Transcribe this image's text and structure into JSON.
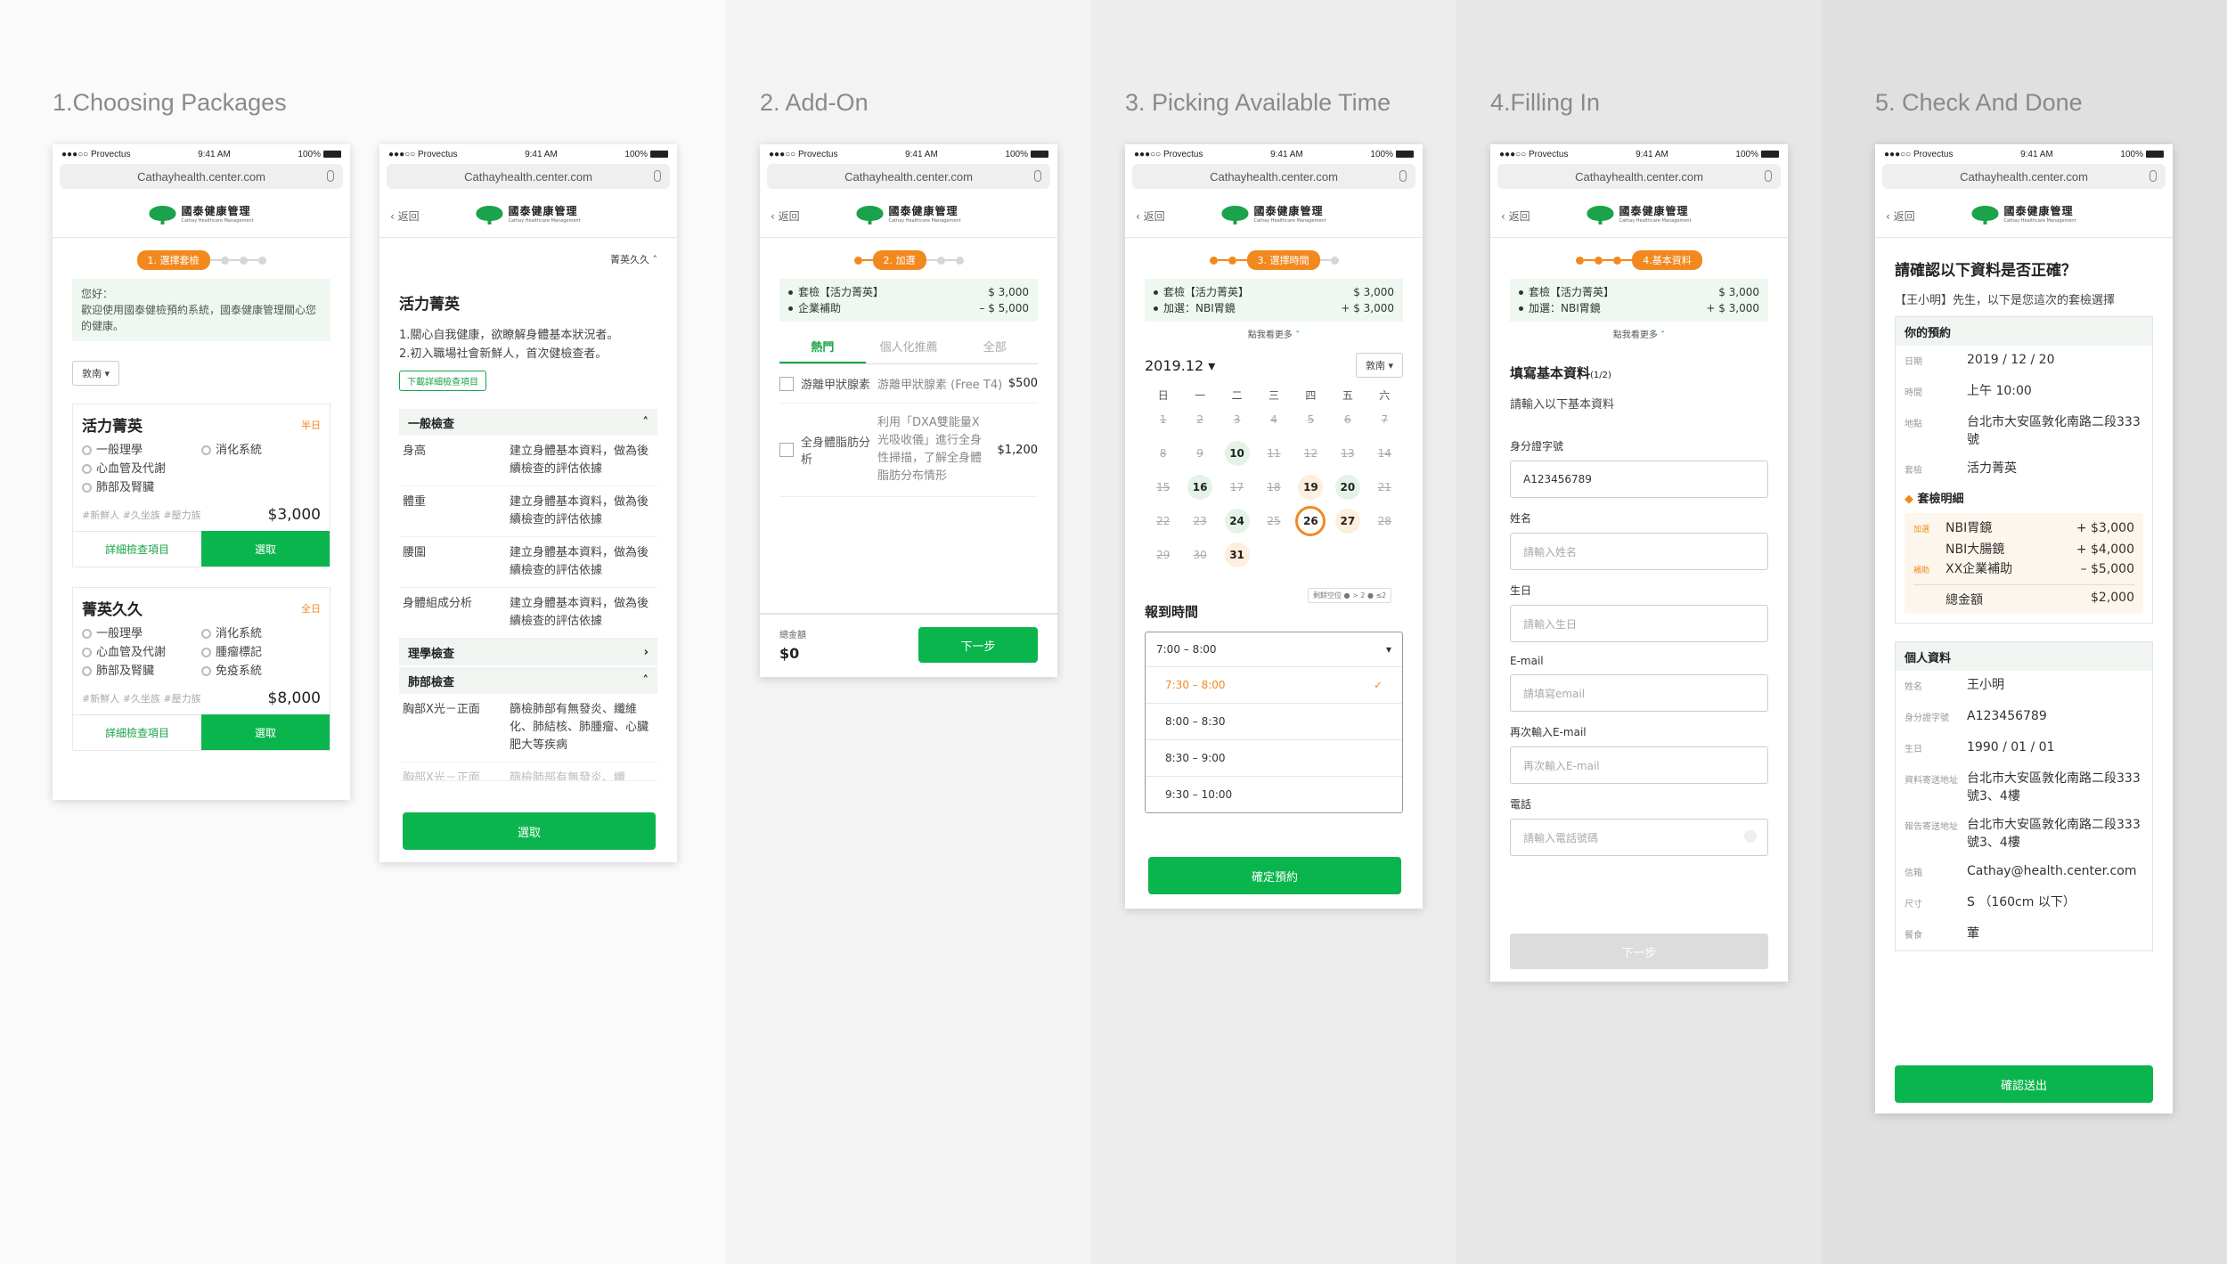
{
  "stages": [
    {
      "title": "1.Choosing Packages"
    },
    {
      "title": "2. Add-On"
    },
    {
      "title": "3. Picking Available Time"
    },
    {
      "title": "4.Filling In"
    },
    {
      "title": "5. Check And Done"
    }
  ],
  "common": {
    "carrier": "●●●○○ Provectus",
    "time": "9:41 AM",
    "battery": "100%",
    "url": "Cathayhealth.center.com",
    "back": "返回",
    "logo_zh": "國泰健康管理",
    "logo_en": "Cathay Healthcare Management"
  },
  "p1": {
    "step": "1. 選擇套檢",
    "greet_title": "您好：",
    "greet_body": "歡迎使用國泰健檢預約系統，國泰健康管理關心您的健康。",
    "filter": "敦南",
    "pkg1": {
      "name": "活力菁英",
      "tag": "半日",
      "f1": "一般理學",
      "f2": "消化系統",
      "f3": "心血管及代謝",
      "f4": "肺部及腎臟",
      "hash": "#新鮮人 #久坐族 #壓力族",
      "price": "$3,000",
      "detail": "詳細檢查項目",
      "choose": "選取"
    },
    "pkg2": {
      "name": "菁英久久",
      "tag": "全日",
      "f1": "一般理學",
      "f2": "消化系統",
      "f3": "心血管及代謝",
      "f4": "腫瘤標記",
      "f5": "肺部及腎臟",
      "f6": "免疫系統",
      "hash": "#新鮮人 #久坐族 #壓力族",
      "price": "$8,000",
      "detail": "詳細檢查項目",
      "choose": "選取"
    }
  },
  "p1b": {
    "collapse": "菁英久久",
    "title": "活力菁英",
    "desc1": "1.關心自我健康，欲瞭解身體基本狀況者。",
    "desc2": "2.初入職場社會新鮮人，首次健檢查者。",
    "download": "下載詳細檢查項目",
    "sec1": "一般檢查",
    "rows": [
      {
        "k": "身高",
        "v": "建立身體基本資料，做為後續檢查的評估依據"
      },
      {
        "k": "體重",
        "v": "建立身體基本資料，做為後續檢查的評估依據"
      },
      {
        "k": "腰圍",
        "v": "建立身體基本資料，做為後續檢查的評估依據"
      },
      {
        "k": "身體組成分析",
        "v": "建立身體基本資料，做為後續檢查的評估依據"
      }
    ],
    "sec2": "理學檢查",
    "sec3": "肺部檢查",
    "lung_k": "胸部X光－正面",
    "lung_v": "篩檢肺部有無發炎、纖維化、肺結核、肺腫瘤、心臟肥大等疾病",
    "lung_k2": "胸部X光－正面",
    "lung_v2": "篩檢肺部有無發炎、纖",
    "choose": "選取"
  },
  "p2": {
    "step": "2. 加選",
    "sum": [
      {
        "k": "套檢【活力菁英】",
        "v": "$ 3,000"
      },
      {
        "k": "企業補助",
        "v": "– $ 5,000"
      }
    ],
    "tabs": [
      "熱門",
      "個人化推薦",
      "全部"
    ],
    "a1": {
      "name": "游離甲狀腺素",
      "desc": "游離甲狀腺素 (Free T4)",
      "price": "$500"
    },
    "a2": {
      "name": "全身體脂肪分析",
      "desc": "利用「DXA雙能量X光吸收儀」進行全身性掃描，了解全身體脂肪分布情形",
      "price": "$1,200"
    },
    "total_label": "總金額",
    "total": "$0",
    "next": "下一步"
  },
  "p3": {
    "step": "3. 選擇時間",
    "sum": [
      {
        "k": "套檢【活力菁英】",
        "v": "$ 3,000"
      },
      {
        "k": "加選：NBI胃鏡",
        "v": "+ $ 3,000"
      }
    ],
    "more": "點我看更多",
    "month": "2019.12",
    "loc": "敦南",
    "weekdays": [
      "日",
      "一",
      "二",
      "三",
      "四",
      "五",
      "六"
    ],
    "days": [
      {
        "d": "1",
        "s": "past"
      },
      {
        "d": "2",
        "s": "past"
      },
      {
        "d": "3",
        "s": "past"
      },
      {
        "d": "4",
        "s": "past"
      },
      {
        "d": "5",
        "s": "past"
      },
      {
        "d": "6",
        "s": "past"
      },
      {
        "d": "7",
        "s": "past"
      },
      {
        "d": "8",
        "s": "past"
      },
      {
        "d": "9",
        "s": "past"
      },
      {
        "d": "10",
        "s": "avail"
      },
      {
        "d": "11",
        "s": "past"
      },
      {
        "d": "12",
        "s": "past"
      },
      {
        "d": "13",
        "s": "past"
      },
      {
        "d": "14",
        "s": "past"
      },
      {
        "d": "15",
        "s": "past"
      },
      {
        "d": "16",
        "s": "avail"
      },
      {
        "d": "17",
        "s": "past"
      },
      {
        "d": "18",
        "s": "past"
      },
      {
        "d": "19",
        "s": "few"
      },
      {
        "d": "20",
        "s": "avail"
      },
      {
        "d": "21",
        "s": "past"
      },
      {
        "d": "22",
        "s": "past"
      },
      {
        "d": "23",
        "s": "past"
      },
      {
        "d": "24",
        "s": "avail"
      },
      {
        "d": "25",
        "s": "past"
      },
      {
        "d": "26",
        "s": "sel"
      },
      {
        "d": "27",
        "s": "few"
      },
      {
        "d": "28",
        "s": "past"
      },
      {
        "d": "29",
        "s": "past"
      },
      {
        "d": "30",
        "s": "past"
      },
      {
        "d": "31",
        "s": "few"
      }
    ],
    "legend": "剩餘空位 ● > 2 ● ≤2",
    "time_title": "報到時間",
    "time_value": "7:00 – 8:00",
    "options": [
      "7:30 – 8:00",
      "8:00 – 8:30",
      "8:30 – 9:00",
      "9:30 – 10:00"
    ],
    "confirm": "確定預約"
  },
  "p4": {
    "step": "4.基本資料",
    "sum": [
      {
        "k": "套檢【活力菁英】",
        "v": "$ 3,000"
      },
      {
        "k": "加選：NBI胃鏡",
        "v": "+ $ 3,000"
      }
    ],
    "more": "點我看更多",
    "title": "填寫基本資料",
    "title_sub": "(1/2)",
    "sub": "請輸入以下基本資料",
    "fields": [
      {
        "label": "身分證字號",
        "value": "A123456789",
        "filled": true
      },
      {
        "label": "姓名",
        "value": "請輸入姓名",
        "filled": false
      },
      {
        "label": "生日",
        "value": "請輸入生日",
        "filled": false
      },
      {
        "label": "E-mail",
        "value": "請填寫email",
        "filled": false
      },
      {
        "label": "再次輸入E-mail",
        "value": "再次輸入E-mail",
        "filled": false
      },
      {
        "label": "電話",
        "value": "請輸入電話號碼",
        "filled": false
      }
    ],
    "next": "下一步"
  },
  "p5": {
    "title": "請確認以下資料是否正確？",
    "sub": "【王小明】先生，以下是您這次的套檢選擇",
    "booking_head": "你的預約",
    "booking": [
      {
        "k": "日期",
        "v": "2019 / 12 / 20"
      },
      {
        "k": "時間",
        "v": "上午 10:00"
      },
      {
        "k": "地點",
        "v": "台北市大安區敦化南路二段333號"
      },
      {
        "k": "套檢",
        "v": "活力菁英"
      }
    ],
    "detail_title": "套檢明細",
    "detail": [
      {
        "tag": "加選",
        "name": "NBI胃鏡",
        "price": "+ $3,000"
      },
      {
        "tag": "",
        "name": "NBI大腸鏡",
        "price": "+ $4,000"
      },
      {
        "tag": "補助",
        "name": "XX企業補助",
        "price": "– $5,000"
      }
    ],
    "total_label": "總金額",
    "total": "$2,000",
    "personal_head": "個人資料",
    "personal": [
      {
        "k": "姓名",
        "v": "王小明"
      },
      {
        "k": "身分證字號",
        "v": "A123456789"
      },
      {
        "k": "生日",
        "v": "1990 / 01 / 01"
      },
      {
        "k": "資料寄送地址",
        "v": "台北市大安區敦化南路二段333號3、4樓"
      },
      {
        "k": "報告寄送地址",
        "v": "台北市大安區敦化南路二段333號3、4樓"
      },
      {
        "k": "信箱",
        "v": "Cathay@health.center.com"
      },
      {
        "k": "尺寸",
        "v": "S （160cm 以下）"
      },
      {
        "k": "餐食",
        "v": "葷"
      }
    ],
    "submit": "確認送出"
  }
}
